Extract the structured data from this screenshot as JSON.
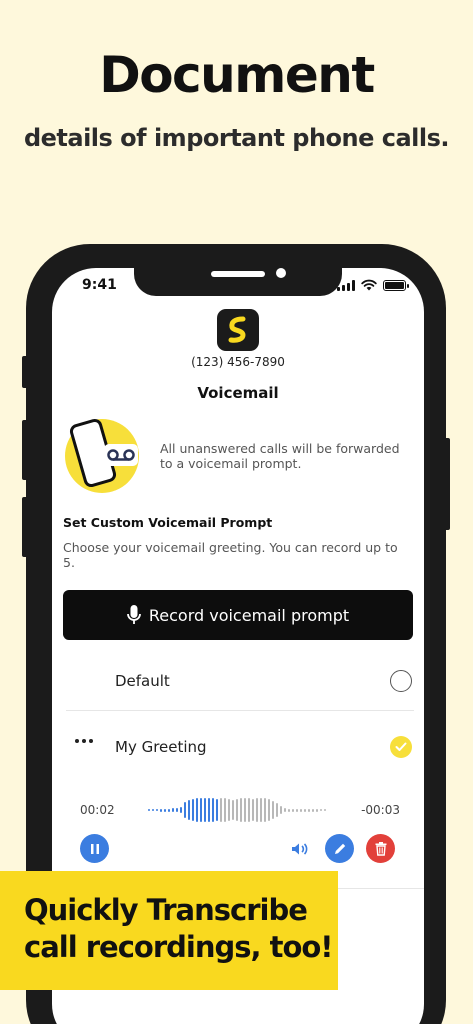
{
  "promo": {
    "headline": "Document",
    "subhead": "details of important phone calls."
  },
  "status_bar": {
    "time": "9:41"
  },
  "app": {
    "logo_icon": "lightning-s-logo-icon",
    "phone_number": "(123) 456-7890",
    "title": "Voicemail"
  },
  "voicemail": {
    "forward_text": "All unanswered calls will be forwarded to a voicemail prompt.",
    "section_title": "Set Custom Voicemail Prompt",
    "section_desc": "Choose your voicemail greeting. You can record up to 5.",
    "record_button": "Record voicemail prompt"
  },
  "prompts": [
    {
      "label": "Default",
      "selected": false
    },
    {
      "label": "My Greeting",
      "selected": true
    }
  ],
  "player": {
    "elapsed": "00:02",
    "remaining": "-00:03",
    "progress": 0.4
  },
  "banner": {
    "text": "Quickly Transcribe call recordings, too!"
  },
  "colors": {
    "background": "#FEF8DC",
    "accent_yellow": "#F9D91F",
    "blue": "#3B7DE0",
    "red": "#E2403A"
  }
}
